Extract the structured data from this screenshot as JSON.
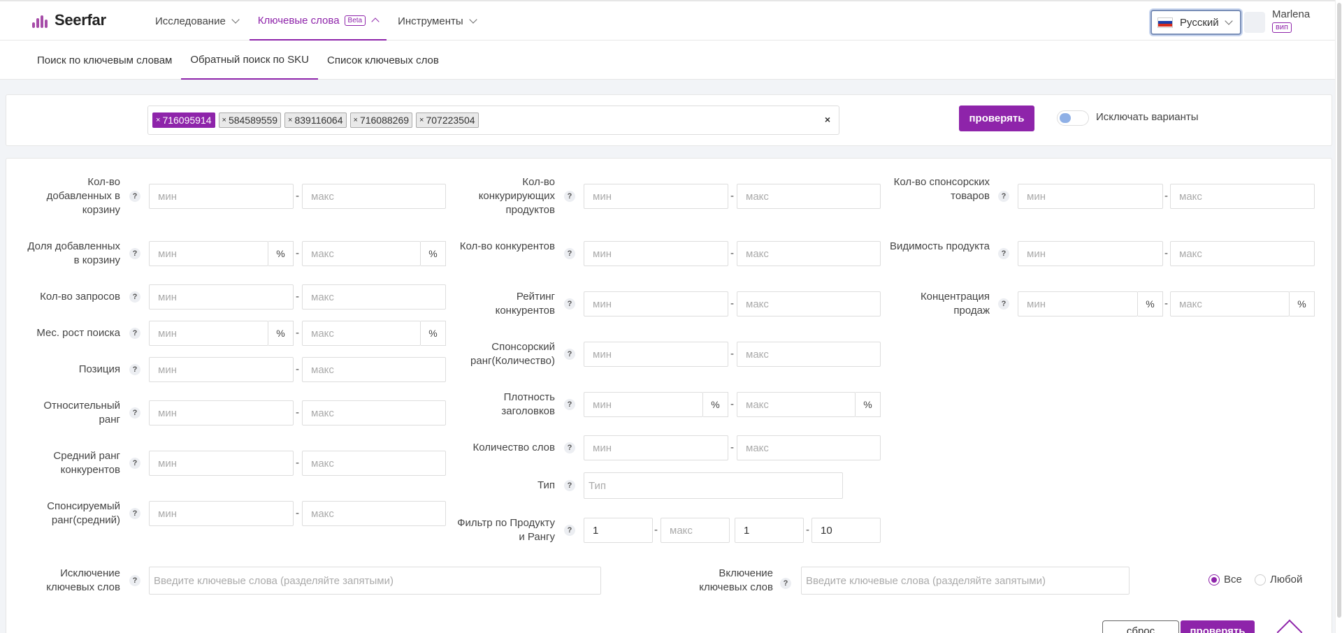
{
  "colors": {
    "accent": "#8e24aa",
    "background": "#f2f4f7"
  },
  "header": {
    "logo_text": "Seerfar",
    "nav": [
      {
        "label": "Исследование"
      },
      {
        "label": "Ключевые слова",
        "badge": "Beta"
      },
      {
        "label": "Инструменты"
      }
    ],
    "language": "Русский",
    "user_name": "Marlena",
    "user_badge": "вип"
  },
  "subtabs": [
    "Поиск по ключевым словам",
    "Обратный поиск по SKU",
    "Список ключевых слов"
  ],
  "search": {
    "tags": [
      "716095914",
      "584589559",
      "839116064",
      "716088269",
      "707223504"
    ],
    "clear_symbol": "×",
    "tag_remove_symbol": "×",
    "submit_label": "проверять",
    "toggle_label": "Исключать варианты"
  },
  "filters": {
    "min_placeholder": "мин",
    "max_placeholder": "макс",
    "help_symbol": "?",
    "dash": "-",
    "percent": "%",
    "col1": [
      {
        "label": "Кол-во добавленных в корзину"
      },
      {
        "label": "Доля добавленных в корзину"
      },
      {
        "label": "Кол-во запросов"
      },
      {
        "label": "Мес. рост поиска"
      },
      {
        "label": "Позиция"
      },
      {
        "label": "Относительный ранг"
      },
      {
        "label": "Средний ранг конкурентов"
      },
      {
        "label": "Спонсируемый ранг(средний)"
      }
    ],
    "col2": [
      {
        "label": "Кол-во конкурирующих продуктов"
      },
      {
        "label": "Кол-во конкурентов"
      },
      {
        "label": "Рейтинг конкурентов"
      },
      {
        "label": "Спонсорский ранг(Количество)"
      },
      {
        "label": "Плотность заголовков"
      },
      {
        "label": "Количество слов"
      },
      {
        "label": "Тип",
        "placeholder": "Тип"
      },
      {
        "label": "Фильтр по Продукту и Рангу",
        "values": [
          "1",
          "1",
          "10"
        ]
      }
    ],
    "col3": [
      {
        "label": "Кол-во спонсорских товаров"
      },
      {
        "label": "Видимость продукта"
      },
      {
        "label": "Концентрация продаж"
      }
    ],
    "exclude_label": "Исключение ключевых слов",
    "include_label": "Включение ключевых слов",
    "keywords_placeholder": "Введите ключевые слова (разделяйте запятыми)",
    "match_all": "Все",
    "match_any": "Любой",
    "match_selected": "Все"
  },
  "footer": {
    "reset_label": "сброс",
    "submit_label": "проверять"
  }
}
